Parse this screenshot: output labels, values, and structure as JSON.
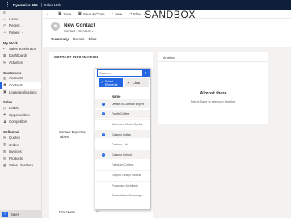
{
  "topbar": {
    "app_name": "Dynamics 365",
    "app_sub": "Sales Hub",
    "waffle_icon": "waffle-icon"
  },
  "sandbox_label": "SANDBOX",
  "commands": [
    {
      "label": "",
      "icon": "back-icon"
    },
    {
      "label": "Save",
      "icon": "save-icon"
    },
    {
      "label": "Save & Close",
      "icon": "save-close-icon"
    },
    {
      "label": "New",
      "icon": "plus-icon"
    },
    {
      "label": "Flow",
      "icon": "flow-icon"
    }
  ],
  "sidebar": {
    "top": [
      {
        "label": "Home",
        "icon": "home-icon"
      },
      {
        "label": "Recent",
        "icon": "clock-icon",
        "chevron": true
      },
      {
        "label": "Pinned",
        "icon": "pin-icon",
        "chevron": true
      }
    ],
    "groups": [
      {
        "title": "My Work",
        "items": [
          {
            "label": "Sales accelerator",
            "icon": "accelerator-icon"
          },
          {
            "label": "Dashboards",
            "icon": "dashboard-icon"
          },
          {
            "label": "Activities",
            "icon": "activities-icon"
          }
        ]
      },
      {
        "title": "Customers",
        "items": [
          {
            "label": "Accounts",
            "icon": "accounts-icon"
          },
          {
            "label": "Contacts",
            "icon": "contacts-icon",
            "active": true
          },
          {
            "label": "Leaanapplications",
            "icon": "apps-icon"
          }
        ]
      },
      {
        "title": "Sales",
        "items": [
          {
            "label": "Leads",
            "icon": "leads-icon"
          },
          {
            "label": "Opportunities",
            "icon": "opportunities-icon"
          },
          {
            "label": "Competitors",
            "icon": "competitors-icon"
          }
        ]
      },
      {
        "title": "Collateral",
        "items": [
          {
            "label": "Quotes",
            "icon": "quotes-icon"
          },
          {
            "label": "Orders",
            "icon": "orders-icon"
          },
          {
            "label": "Invoices",
            "icon": "invoices-icon"
          },
          {
            "label": "Products",
            "icon": "products-icon"
          },
          {
            "label": "Sales Literature",
            "icon": "literature-icon"
          }
        ]
      }
    ],
    "area": {
      "badge": "S",
      "label": "Sales"
    }
  },
  "header": {
    "title": "New Contact",
    "subtitle": "Contact · Contact ⌄"
  },
  "tabs": [
    "Summary",
    "Details",
    "Files"
  ],
  "section": {
    "title": "CONTACT INFORMATION",
    "field_label": "Contact Expertise Tables",
    "first_name_label": "First Name",
    "first_name_value": "---"
  },
  "dropdown": {
    "search_placeholder": "Search...",
    "select_label": "Select Elements",
    "clear_label": "Clear",
    "list_header": "Name",
    "options": [
      {
        "label": "Details of Contract Expert",
        "checked": true
      },
      {
        "label": "Fourth Coffee",
        "checked": true
      },
      {
        "label": "Adventure Works Cycles",
        "checked": false
      },
      {
        "label": "Contoso Suites",
        "checked": true
      },
      {
        "label": "Contoso, Ltd.",
        "checked": false
      },
      {
        "label": "Contoso School",
        "checked": true
      },
      {
        "label": "Fabrikam College",
        "checked": false
      },
      {
        "label": "Graphic Design Institute",
        "checked": false
      },
      {
        "label": "Proseware Architects",
        "checked": false
      },
      {
        "label": "Consolidated Messenger",
        "checked": false
      }
    ]
  },
  "timeline": {
    "title": "Timeline",
    "empty_title": "Almost there",
    "empty_msg": "Select Save to see your timeline."
  },
  "colors": {
    "accent": "#2266e3",
    "topbar": "#0f1f3a"
  }
}
